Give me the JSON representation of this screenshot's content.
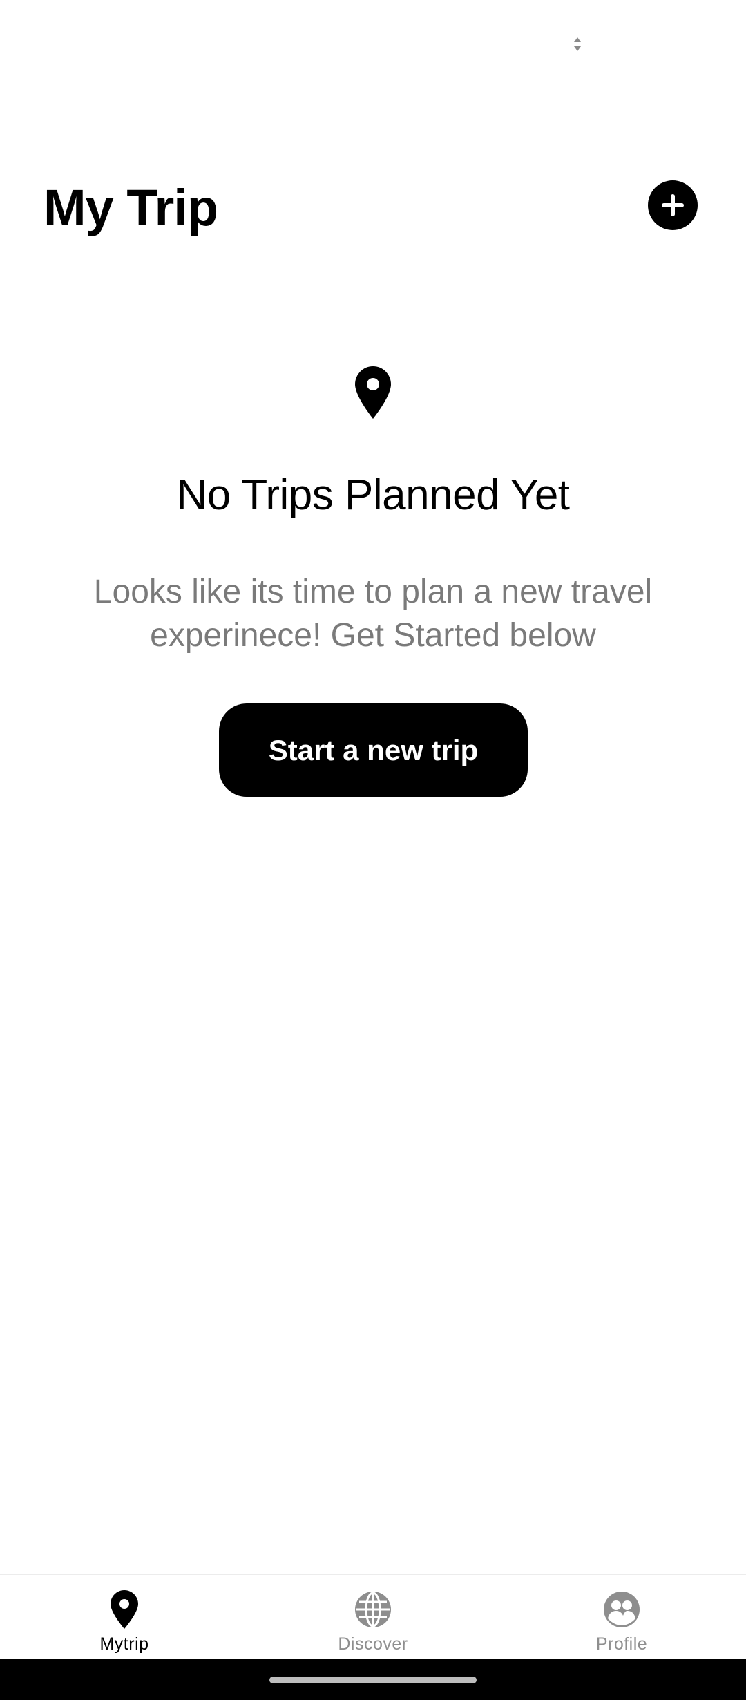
{
  "header": {
    "title": "My Trip",
    "add_icon": "plus-circle-icon"
  },
  "empty_state": {
    "icon": "map-pin-icon",
    "title": "No Trips Planned Yet",
    "subtitle": "Looks like its time to plan a new travel experinece! Get Started below",
    "button_label": "Start a new trip"
  },
  "bottom_nav": {
    "items": [
      {
        "label": "Mytrip",
        "icon": "map-pin-icon",
        "active": true
      },
      {
        "label": "Discover",
        "icon": "globe-icon",
        "active": false
      },
      {
        "label": "Profile",
        "icon": "people-icon",
        "active": false
      }
    ]
  },
  "colors": {
    "primary": "#000000",
    "background": "#ffffff",
    "muted_text": "#7a7a7a",
    "inactive_nav": "#8e8e8e"
  }
}
